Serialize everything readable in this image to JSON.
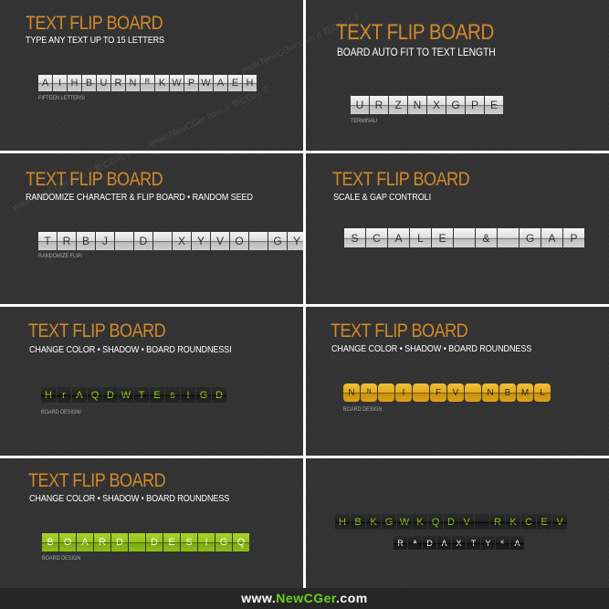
{
  "watermark": "www.NewCGer.com // 新CG儿 //",
  "panels": [
    {
      "title": "TEXT FLIP BOARD",
      "subtitle": "TYPE ANY TEXT UP TO 15 LETTERS",
      "board": [
        "A",
        "I",
        "H",
        "B",
        "U",
        "R",
        "N",
        "ᴿ",
        "K",
        "W",
        "P",
        "W",
        "A",
        "E",
        "H"
      ],
      "caption": "FIFTEEN LETTERSI"
    },
    {
      "title": "TEXT FLIP BOARD",
      "subtitle": "BOARD AUTO FIT TO TEXT LENGTH",
      "board": [
        "U",
        "R",
        "Z",
        "N",
        "X",
        "G",
        "P",
        "E"
      ],
      "caption": "TERMINALI"
    },
    {
      "title": "TEXT FLIP BOARD",
      "subtitle": "RANDOMIZE CHARACTER & FLIP BOARD • RANDOM SEED",
      "board": [
        "T",
        "R",
        "B",
        "J",
        "",
        "D",
        "",
        "X",
        "Y",
        "V",
        "O",
        "",
        "G",
        "Y"
      ],
      "caption": "RANDOMIZE FLIPI"
    },
    {
      "title": "TEXT FLIP BOARD",
      "subtitle": "SCALE & GAP CONTROLI",
      "board": [
        "S",
        "C",
        "A",
        "L",
        "E",
        "",
        "&",
        "",
        "G",
        "A",
        "P"
      ],
      "caption": ""
    },
    {
      "title": "TEXT FLIP BOARD",
      "subtitle": "CHANGE COLOR • SHADOW • BOARD ROUNDNESSI",
      "board": [
        "H",
        "r",
        "A",
        "Q",
        "D",
        "W",
        "T",
        "E",
        "s",
        "I",
        "G",
        "D"
      ],
      "caption": "BOARD DESIGNI"
    },
    {
      "title": "TEXT FLIP BOARD",
      "subtitle": "CHANGE COLOR • SHADOW • BOARD ROUNDNESS",
      "board": [
        "N",
        "ᴺ",
        "",
        "I",
        "",
        "F",
        "V",
        "",
        "N",
        "B",
        "M",
        "L"
      ],
      "caption": "BOARD DESIGN"
    },
    {
      "title": "TEXT FLIP BOARD",
      "subtitle": "CHANGE COLOR • SHADOW • BOARD ROUNDNESS",
      "board": [
        "B",
        "O",
        "A",
        "R",
        "D",
        "",
        "D",
        "E",
        "S",
        "I",
        "G",
        "Q"
      ],
      "caption": "BOARD DESIGN"
    },
    {
      "board_top": [
        "H",
        "B",
        "K",
        "G",
        "W",
        "K",
        "Q",
        "D",
        "V",
        "",
        "R",
        "K",
        "C",
        "E",
        "V"
      ],
      "board_bottom": [
        "R",
        "ᴬ",
        "D",
        "A",
        "X",
        "T",
        "Y",
        "ᴷ",
        "A"
      ]
    }
  ],
  "footer": {
    "prefix": "www.",
    "highlight": "NewCGer",
    "suffix": ".com"
  },
  "colors": {
    "title": "#d18a2a",
    "panel_bg": "#323232",
    "gold_tile": "#e3ab1d",
    "lime_tile": "#94c11b",
    "green_text": "#9ad40a"
  }
}
